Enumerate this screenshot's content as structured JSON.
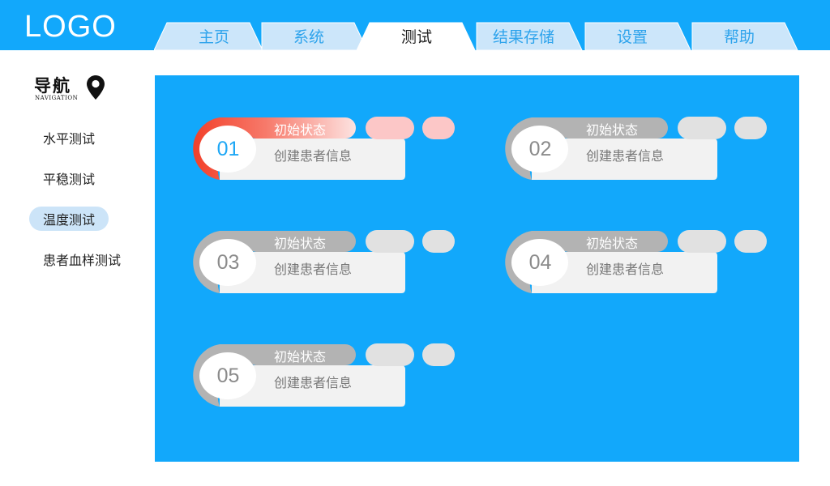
{
  "header": {
    "logo": "LOGO",
    "tabs": [
      {
        "label": "主页",
        "active": false
      },
      {
        "label": "系统",
        "active": false
      },
      {
        "label": "测试",
        "active": true
      },
      {
        "label": "结果存储",
        "active": false
      },
      {
        "label": "设置",
        "active": false
      },
      {
        "label": "帮助",
        "active": false
      }
    ]
  },
  "sidebar": {
    "title": "导航",
    "subtitle": "NAVIGATION",
    "items": [
      {
        "label": "水平测试",
        "active": false
      },
      {
        "label": "平稳测试",
        "active": false
      },
      {
        "label": "温度测试",
        "active": true
      },
      {
        "label": "患者血样测试",
        "active": false
      }
    ]
  },
  "cards": [
    {
      "number": "01",
      "status": "初始状态",
      "info": "创建患者信息",
      "active": true
    },
    {
      "number": "02",
      "status": "初始状态",
      "info": "创建患者信息",
      "active": false
    },
    {
      "number": "03",
      "status": "初始状态",
      "info": "创建患者信息",
      "active": false
    },
    {
      "number": "04",
      "status": "初始状态",
      "info": "创建患者信息",
      "active": false
    },
    {
      "number": "05",
      "status": "初始状态",
      "info": "创建患者信息",
      "active": false
    }
  ],
  "colors": {
    "header_blue": "#12a8fb",
    "tab_fill": "#cce6fa",
    "active_red": "#f2402a",
    "inactive_gray": "#b3b3b3",
    "card_body": "#f2f2f2",
    "pill_red": "#fcc7c7",
    "pill_gray": "#e1e1e1"
  },
  "icons": {
    "nav": "map-pin-icon"
  }
}
